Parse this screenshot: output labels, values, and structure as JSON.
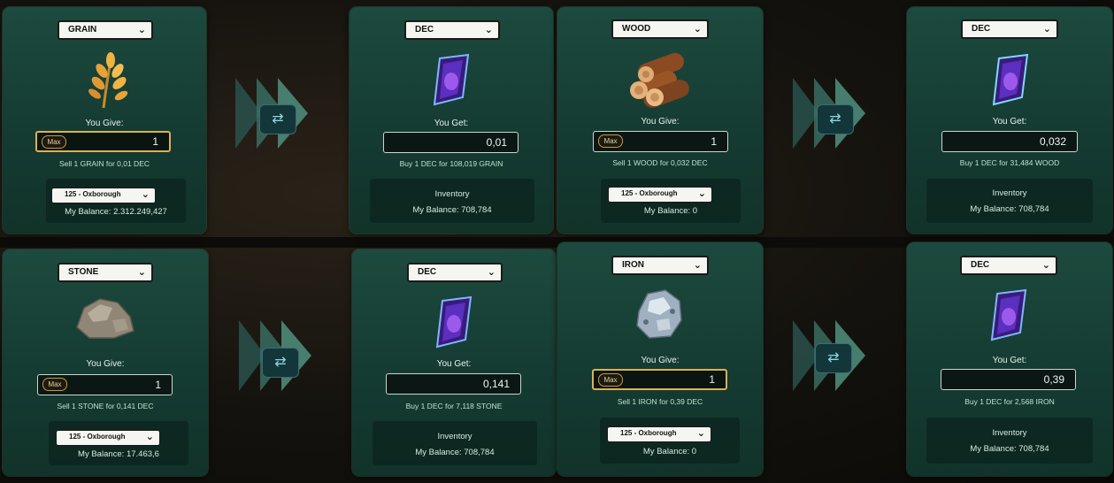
{
  "give_label": "You Give:",
  "get_label": "You Get:",
  "max_label": "Max",
  "inventory_label": "Inventory",
  "swap_glyph": "⇄",
  "icons": [
    "grain-icon",
    "dec-gem-icon",
    "wood-icon",
    "stone-icon",
    "iron-icon",
    "chevron-down-icon",
    "swap-icon"
  ],
  "colors": {
    "card": "#164036",
    "accent_gold": "#d8b257",
    "text": "#e6f2ea"
  },
  "trades": [
    {
      "give": {
        "resource": "GRAIN",
        "amount": "1",
        "rate": "Sell 1 GRAIN for 0,01 DEC",
        "location": "125 - Oxborough",
        "balance": "My Balance: 2.312.249,427"
      },
      "get": {
        "resource": "DEC",
        "amount": "0,01",
        "rate": "Buy 1 DEC for 108,019 GRAIN",
        "balance": "My Balance: 708,784"
      }
    },
    {
      "give": {
        "resource": "WOOD",
        "amount": "1",
        "rate": "Sell 1 WOOD for 0,032 DEC",
        "location": "125 - Oxborough",
        "balance": "My Balance: 0"
      },
      "get": {
        "resource": "DEC",
        "amount": "0,032",
        "rate": "Buy 1 DEC for 31,484 WOOD",
        "balance": "My Balance: 708,784"
      }
    },
    {
      "give": {
        "resource": "STONE",
        "amount": "1",
        "rate": "Sell 1 STONE for 0,141 DEC",
        "location": "125 - Oxborough",
        "balance": "My Balance: 17.463,6"
      },
      "get": {
        "resource": "DEC",
        "amount": "0,141",
        "rate": "Buy 1 DEC for 7,118 STONE",
        "balance": "My Balance: 708,784"
      }
    },
    {
      "give": {
        "resource": "IRON",
        "amount": "1",
        "rate": "Sell 1 IRON for 0,39 DEC",
        "location": "125 - Oxborough",
        "balance": "My Balance: 0"
      },
      "get": {
        "resource": "DEC",
        "amount": "0,39",
        "rate": "Buy 1 DEC for 2,568 IRON",
        "balance": "My Balance: 708,784"
      }
    }
  ]
}
